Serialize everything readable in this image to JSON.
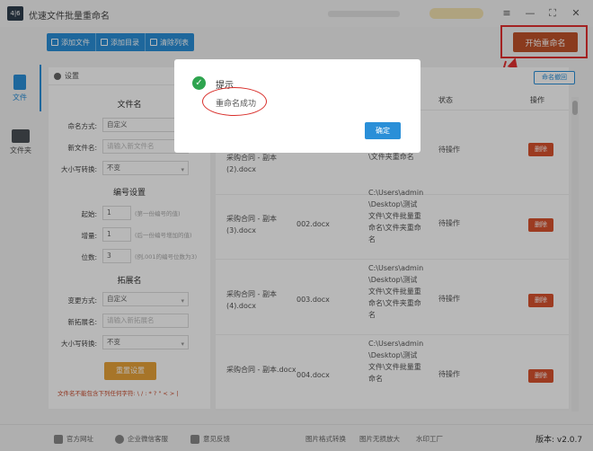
{
  "titlebar": {
    "logo_text": "4|6",
    "title": "优速文件批量重命名"
  },
  "toolbar": {
    "add_file": "添加文件",
    "add_folder": "添加目录",
    "clear_list": "清除列表"
  },
  "start_button": "开始重命名",
  "nav": {
    "file_label": "文件",
    "folder_label": "文件夹"
  },
  "settings": {
    "header": "设置",
    "file_name_section": "文件名",
    "rename_mode_label": "命名方式:",
    "rename_mode_value": "自定义",
    "new_name_label": "新文件名:",
    "new_name_placeholder": "请输入新文件名",
    "case_label": "大小写转换:",
    "case_value": "不变",
    "number_section": "编号设置",
    "start_label": "起始:",
    "start_value": "1",
    "start_hint": "(第一份编号的值)",
    "increment_label": "增量:",
    "increment_value": "1",
    "increment_hint": "(后一份编号增加的值)",
    "digits_label": "位数:",
    "digits_value": "3",
    "digits_hint": "(例,001的编号位数为3)",
    "ext_section": "拓展名",
    "ext_mode_label": "变更方式:",
    "ext_mode_value": "自定义",
    "new_ext_label": "新拓展名:",
    "new_ext_placeholder": "请输入新拓展名",
    "ext_case_label": "大小写转换:",
    "ext_case_value": "不变",
    "reset_button": "重置设置",
    "note": "文件名不能包含下列任何字符: \\ / : * ? \" < > |"
  },
  "table": {
    "undo_button": "命名撤回",
    "headers": {
      "status": "状态",
      "action": "操作"
    },
    "rows": [
      {
        "orig": "采购合同 - 副本 (2).docx",
        "new": "",
        "path": "\\文件批量重命名\\文件夹重命名",
        "status": "待操作",
        "delete": "删除"
      },
      {
        "orig": "采购合同 - 副本 (3).docx",
        "new": "002.docx",
        "path": "C:\\Users\\admin\\Desktop\\测试文件\\文件批量重命名\\文件夹重命名",
        "status": "待操作",
        "delete": "删除"
      },
      {
        "orig": "采购合同 - 副本 (4).docx",
        "new": "003.docx",
        "path": "C:\\Users\\admin\\Desktop\\测试文件\\文件批量重命名\\文件夹重命名",
        "status": "待操作",
        "delete": "删除"
      },
      {
        "orig": "采购合同 - 副本.docx",
        "new": "004.docx",
        "path": "C:\\Users\\admin\\Desktop\\测试文件\\文件批量重命名",
        "status": "待操作",
        "delete": "删除"
      }
    ]
  },
  "footer": {
    "official_site": "官方网址",
    "enterprise_service": "企业微信客服",
    "feedback": "意见反馈",
    "img_convert": "图片格式转换",
    "img_enlarge": "图片无损放大",
    "water_factory": "水印工厂",
    "version": "版本: v2.0.7"
  },
  "modal": {
    "title": "提示",
    "message": "重命名成功",
    "ok_button": "确定"
  }
}
